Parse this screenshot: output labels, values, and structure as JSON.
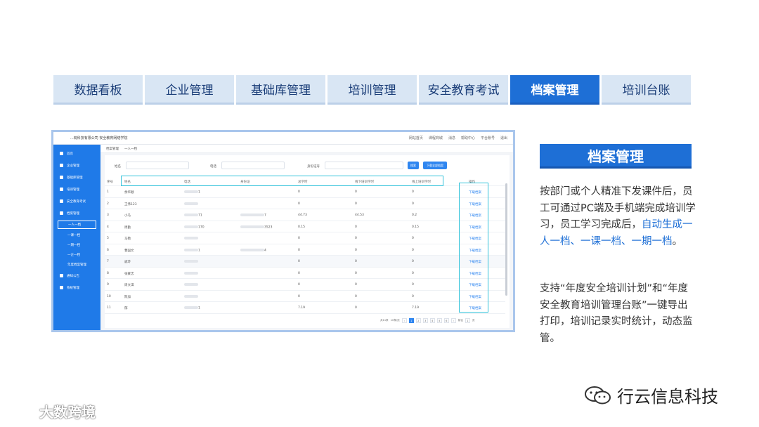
{
  "tabs": [
    {
      "label": "数据看板",
      "active": false
    },
    {
      "label": "企业管理",
      "active": false
    },
    {
      "label": "基础库管理",
      "active": false
    },
    {
      "label": "培训管理",
      "active": false
    },
    {
      "label": "安全教育考试",
      "active": false
    },
    {
      "label": "档案管理",
      "active": true
    },
    {
      "label": "培训台账",
      "active": false
    }
  ],
  "app": {
    "title": "...皖科技有限公司 安全教育网络学院",
    "top_right": [
      "网站首页",
      "课程商城",
      "消息",
      "帮助中心",
      "平台账号",
      "退出"
    ],
    "sidebar": {
      "items": [
        {
          "label": "首页",
          "icon": "home-icon"
        },
        {
          "label": "企业管理",
          "icon": "building-icon"
        },
        {
          "label": "基础库管理",
          "icon": "list-icon"
        },
        {
          "label": "培训管理",
          "icon": "monitor-icon"
        },
        {
          "label": "安全教育考试",
          "icon": "shield-icon"
        },
        {
          "label": "档案管理",
          "icon": "folder-icon"
        }
      ],
      "subitems": [
        "一人一档",
        "一课一档",
        "一期一档",
        "一企一档",
        "年度档案管理"
      ],
      "bottom_items": [
        {
          "label": "通知公告",
          "icon": "speaker-icon"
        },
        {
          "label": "系统管理",
          "icon": "gear-icon"
        }
      ]
    },
    "breadcrumb": [
      "档案管理",
      "一人一档"
    ],
    "filters": {
      "name_label": "姓名",
      "phone_label": "电话",
      "idcard_label": "身份证号",
      "search_button": "搜索",
      "download_button": "下载全部档案"
    },
    "table": {
      "headers": [
        "序号",
        "姓名",
        "电话",
        "身份证",
        "总学时",
        "线下培训学时",
        "线上培训学时",
        "操作"
      ],
      "rows": [
        {
          "no": "1",
          "name": "余华顺",
          "phone": "1",
          "idcard": "",
          "total": "0",
          "offline": "0",
          "online": "0",
          "action": "下载档案"
        },
        {
          "no": "2",
          "name": "王伟123",
          "phone": "",
          "idcard": "",
          "total": "0",
          "offline": "0",
          "online": "0",
          "action": "下载档案"
        },
        {
          "no": "3",
          "name": "小马",
          "phone": "71",
          "idcard": "7",
          "total": "44.73",
          "offline": "44.53",
          "online": "0.2",
          "action": "下载档案"
        },
        {
          "no": "4",
          "name": "周勤",
          "phone": "170",
          "idcard": "3523",
          "total": "0.15",
          "offline": "0",
          "online": "0.15",
          "action": "下载档案"
        },
        {
          "no": "5",
          "name": "马勒",
          "phone": "",
          "idcard": "",
          "total": "0",
          "offline": "0",
          "online": "0",
          "action": "下载档案"
        },
        {
          "no": "6",
          "name": "曹国文",
          "phone": "1",
          "idcard": "4",
          "total": "0",
          "offline": "0",
          "online": "0",
          "action": "下载档案"
        },
        {
          "no": "7",
          "name": "戚玲",
          "phone": "",
          "idcard": "",
          "total": "0",
          "offline": "0",
          "online": "0",
          "action": "下载档案"
        },
        {
          "no": "8",
          "name": "张蒙忠",
          "phone": "",
          "idcard": "",
          "total": "0",
          "offline": "0",
          "online": "0",
          "action": "下载档案"
        },
        {
          "no": "9",
          "name": "周文琪",
          "phone": "",
          "idcard": "",
          "total": "0",
          "offline": "0",
          "online": "0",
          "action": "下载档案"
        },
        {
          "no": "10",
          "name": "陈加",
          "phone": "",
          "idcard": "",
          "total": "0",
          "offline": "0",
          "online": "0",
          "action": "下载档案"
        },
        {
          "no": "11",
          "name": "郁",
          "phone": "1",
          "idcard": "",
          "total": "7.19",
          "offline": "0",
          "online": "7.19",
          "action": "下载档案"
        }
      ]
    },
    "pager": {
      "total": "共11条",
      "page_size": "10条/页",
      "pages": [
        "1",
        "2",
        "3",
        "4",
        "5",
        "6"
      ],
      "current": "1",
      "goto_label": "前往",
      "goto_value": "1",
      "goto_suffix": "页"
    }
  },
  "right": {
    "heading": "档案管理",
    "p1_plain": "按部门或个人精准下发课件后，员工可通过PC端及手机端完成培训学习，员工学习完成后，",
    "p1_em": "自动生成一人一档、一课一档、一期一档",
    "p1_end": "。",
    "p2": "支持“年度安全培训计划”和“年度安全教育培训管理台账”一键导出打印，培训记录实时统计，动态监管。"
  },
  "brand": "行云信息科技",
  "watermark": "大数跨境",
  "colors": {
    "accent": "#1e6fd6",
    "tab_bg": "#d9e6f4",
    "sidebar": "#1f7ae8",
    "highlight": "#31c2da"
  }
}
